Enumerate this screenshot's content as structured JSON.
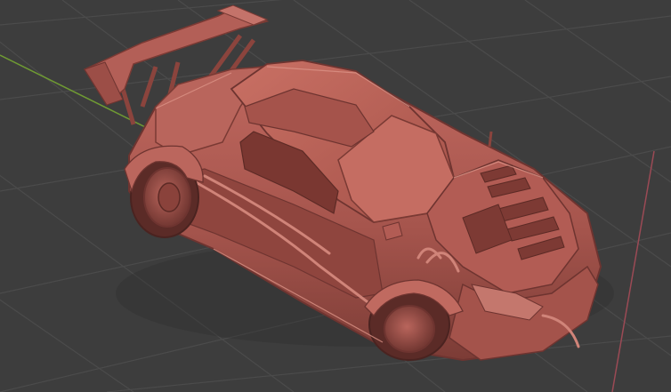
{
  "viewport": {
    "background_color": "#3d3d3d",
    "grid_color": "#4a4a4a",
    "x_axis_color": "#9b4a55",
    "y_axis_color": "#6f9a33",
    "grid_visible": true,
    "view_mode": "perspective",
    "shading": "solid"
  },
  "model": {
    "type": "sports car sculpt",
    "material_color": "#b55e57",
    "shadow_color": "#6e3430",
    "highlight_color": "#d58a80"
  }
}
